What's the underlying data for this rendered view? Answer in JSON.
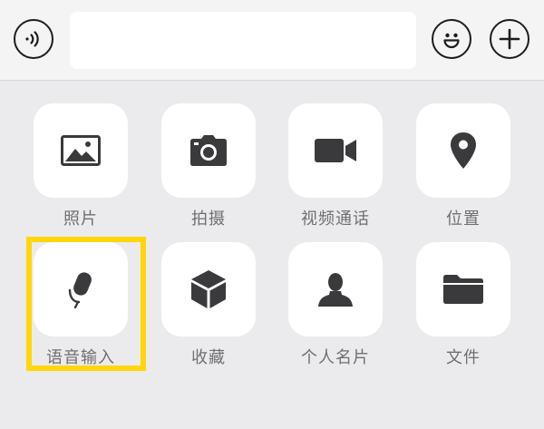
{
  "input_bar": {
    "text_value": "",
    "placeholder": "",
    "voice_toggle_icon": "voice-waves-icon",
    "emoji_icon": "smiley-face-icon",
    "more_icon": "plus-icon"
  },
  "panel": {
    "items": [
      {
        "label": "照片",
        "icon": "photo-icon"
      },
      {
        "label": "拍摄",
        "icon": "camera-icon"
      },
      {
        "label": "视频通话",
        "icon": "video-camera-icon"
      },
      {
        "label": "位置",
        "icon": "location-pin-icon"
      },
      {
        "label": "语音输入",
        "icon": "microphone-icon"
      },
      {
        "label": "收藏",
        "icon": "cube-icon"
      },
      {
        "label": "个人名片",
        "icon": "person-icon"
      },
      {
        "label": "文件",
        "icon": "folder-icon"
      }
    ]
  },
  "colors": {
    "highlight": "#ffd60a",
    "icon": "#3a3a3c",
    "label": "#6f6f73",
    "tile": "#ffffff",
    "background": "#ebebed"
  }
}
